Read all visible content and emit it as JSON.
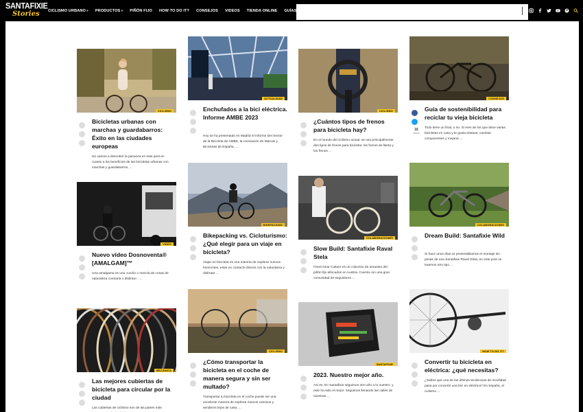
{
  "brand": {
    "line1": "SANTAFIXIE",
    "line2": "Stories"
  },
  "nav": [
    {
      "label": "CICLISMO URBANO",
      "chevron": true
    },
    {
      "label": "PRODUCTOS",
      "chevron": true
    },
    {
      "label": "PIÑÓN FIJO",
      "chevron": false
    },
    {
      "label": "HOW TO DO IT?",
      "chevron": false
    },
    {
      "label": "CONSEJOS",
      "chevron": false
    },
    {
      "label": "VIDEOS",
      "chevron": false
    },
    {
      "label": "TIENDA ONLINE",
      "chevron": false
    },
    {
      "label": "GUÍAS DE COMPRA",
      "chevron": true
    }
  ],
  "social": [
    "instagram-icon",
    "facebook-icon",
    "twitter-icon",
    "youtube-icon",
    "pinterest-icon",
    "search-icon"
  ],
  "colors": {
    "accent": "#f6c622",
    "bg": "#000000",
    "page": "#ffffff",
    "facebook": "#3b5998",
    "twitter": "#1da1f2"
  },
  "posts": [
    {
      "badge": "CICLISMO",
      "title": "Bicicletas urbanas con marchas y guardabarros: Éxito en las ciudades europeas",
      "excerpt": "No vamos a descubrir la panacea en este post en cuanto a los beneficios de las bicicletas urbanas con marchas y guardabarros, ..."
    },
    {
      "badge": "ACTUALIDAD",
      "title": "Enchufados a la bici eléctrica. Informe AMBE 2023",
      "excerpt": "Hoy se ha presentado en Madrid el Informe Del Sector de la Bicicleta de AMBE, la Asociación de Marcas y Bicicletas de España, ..."
    },
    {
      "badge": "CICLISMO",
      "title": "¿Cuántos tipos de frenos para bicicleta hay?",
      "excerpt": "En el mundo del ciclismo actual, se usa principalmente dos tipos de frenos para bicicleta: los frenos de llanta y los frenos ..."
    },
    {
      "badge": "CONSEJOS",
      "title": "Guía de sostenibilidad para reciclar tu vieja bicicleta",
      "excerpt": "Todo tiene un final, o no. Si eres de los que tiene varias bicicletas en casa y te gusta trastear, cambiar componentes y mejorar ...",
      "views": "16",
      "views_label": "Views"
    },
    {
      "badge": "VIDEO",
      "title": "Nuevo vídeo Dosnoventa® [AMALGAM]™",
      "excerpt": "Una amalgama es una «unión o mezcla de cosas de naturaleza contraria o distinta». ..."
    },
    {
      "badge": "BIKEPACKING",
      "title": "Bikepacking vs. Cicloturismo: ¿Qué elegir para un viaje en bicicleta?",
      "excerpt": "Viajar en bicicleta es una manera de explorar nuevos horizontes, estar en contacto directo con la naturaleza y disfrutar ..."
    },
    {
      "badge": "COLABORACIONES",
      "title": "Slow Build: Santafixie Raval Stela",
      "excerpt": "Fixed Gear Culture es un colectivo de amantes del piñón fijo afincados en Austria. Cuenta con una gran comunidad de seguidores ..."
    },
    {
      "badge": "COLABORACIONES",
      "title": "Dream Build: Santafixie Wild",
      "excerpt": "Si hace unos días os presentábamos el montaje sin prisas de una Santafixie Raval Stela, en este post os traemos otro tipo ..."
    },
    {
      "badge": "MECÁNICA",
      "title": "Las mejores cubiertas de bicicleta para circular por la ciudad",
      "excerpt": "Las cubiertas de ciclismo son de las partes más importantes de la bicicleta. Es necesario de ..."
    },
    {
      "badge": "CICLISMO",
      "title": "¿Cómo transportar la bicicleta en el coche de manera segura y sin ser multado?",
      "excerpt": "Transportar tu bicicleta en el coche puede ser una excelente manera de explorar nuevos caminos y senderos lejos de casa. ..."
    },
    {
      "badge": "SANTAFIXIE",
      "title": "2023. Nuestro mejor año.",
      "excerpt": "Así es. En Santafixie seguimos otro año a lo nuestro, y este ha sido el mejor. Seguimos llenando las calles de nuestras ..."
    },
    {
      "badge": "HOW TO DO IT?",
      "title": "Convertir tu bicicleta en eléctrica: ¿qué necesitas?",
      "excerpt": "¿Sabes que una de las últimas tendencias de movilidad pasa por convertir una bici en eléctrica? En España, el ciclismo ..."
    }
  ]
}
